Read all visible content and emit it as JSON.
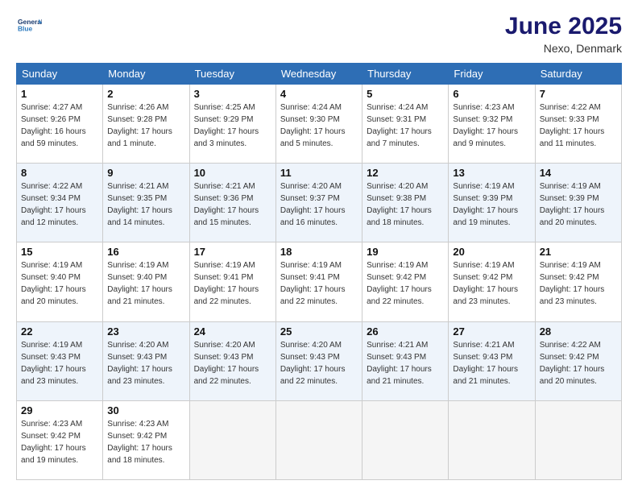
{
  "header": {
    "logo_line1": "General",
    "logo_line2": "Blue",
    "month": "June 2025",
    "location": "Nexo, Denmark"
  },
  "days_of_week": [
    "Sunday",
    "Monday",
    "Tuesday",
    "Wednesday",
    "Thursday",
    "Friday",
    "Saturday"
  ],
  "weeks": [
    [
      {
        "day": "1",
        "sunrise": "4:27 AM",
        "sunset": "9:26 PM",
        "daylight": "16 hours and 59 minutes."
      },
      {
        "day": "2",
        "sunrise": "4:26 AM",
        "sunset": "9:28 PM",
        "daylight": "17 hours and 1 minute."
      },
      {
        "day": "3",
        "sunrise": "4:25 AM",
        "sunset": "9:29 PM",
        "daylight": "17 hours and 3 minutes."
      },
      {
        "day": "4",
        "sunrise": "4:24 AM",
        "sunset": "9:30 PM",
        "daylight": "17 hours and 5 minutes."
      },
      {
        "day": "5",
        "sunrise": "4:24 AM",
        "sunset": "9:31 PM",
        "daylight": "17 hours and 7 minutes."
      },
      {
        "day": "6",
        "sunrise": "4:23 AM",
        "sunset": "9:32 PM",
        "daylight": "17 hours and 9 minutes."
      },
      {
        "day": "7",
        "sunrise": "4:22 AM",
        "sunset": "9:33 PM",
        "daylight": "17 hours and 11 minutes."
      }
    ],
    [
      {
        "day": "8",
        "sunrise": "4:22 AM",
        "sunset": "9:34 PM",
        "daylight": "17 hours and 12 minutes."
      },
      {
        "day": "9",
        "sunrise": "4:21 AM",
        "sunset": "9:35 PM",
        "daylight": "17 hours and 14 minutes."
      },
      {
        "day": "10",
        "sunrise": "4:21 AM",
        "sunset": "9:36 PM",
        "daylight": "17 hours and 15 minutes."
      },
      {
        "day": "11",
        "sunrise": "4:20 AM",
        "sunset": "9:37 PM",
        "daylight": "17 hours and 16 minutes."
      },
      {
        "day": "12",
        "sunrise": "4:20 AM",
        "sunset": "9:38 PM",
        "daylight": "17 hours and 18 minutes."
      },
      {
        "day": "13",
        "sunrise": "4:19 AM",
        "sunset": "9:39 PM",
        "daylight": "17 hours and 19 minutes."
      },
      {
        "day": "14",
        "sunrise": "4:19 AM",
        "sunset": "9:39 PM",
        "daylight": "17 hours and 20 minutes."
      }
    ],
    [
      {
        "day": "15",
        "sunrise": "4:19 AM",
        "sunset": "9:40 PM",
        "daylight": "17 hours and 20 minutes."
      },
      {
        "day": "16",
        "sunrise": "4:19 AM",
        "sunset": "9:40 PM",
        "daylight": "17 hours and 21 minutes."
      },
      {
        "day": "17",
        "sunrise": "4:19 AM",
        "sunset": "9:41 PM",
        "daylight": "17 hours and 22 minutes."
      },
      {
        "day": "18",
        "sunrise": "4:19 AM",
        "sunset": "9:41 PM",
        "daylight": "17 hours and 22 minutes."
      },
      {
        "day": "19",
        "sunrise": "4:19 AM",
        "sunset": "9:42 PM",
        "daylight": "17 hours and 22 minutes."
      },
      {
        "day": "20",
        "sunrise": "4:19 AM",
        "sunset": "9:42 PM",
        "daylight": "17 hours and 23 minutes."
      },
      {
        "day": "21",
        "sunrise": "4:19 AM",
        "sunset": "9:42 PM",
        "daylight": "17 hours and 23 minutes."
      }
    ],
    [
      {
        "day": "22",
        "sunrise": "4:19 AM",
        "sunset": "9:43 PM",
        "daylight": "17 hours and 23 minutes."
      },
      {
        "day": "23",
        "sunrise": "4:20 AM",
        "sunset": "9:43 PM",
        "daylight": "17 hours and 23 minutes."
      },
      {
        "day": "24",
        "sunrise": "4:20 AM",
        "sunset": "9:43 PM",
        "daylight": "17 hours and 22 minutes."
      },
      {
        "day": "25",
        "sunrise": "4:20 AM",
        "sunset": "9:43 PM",
        "daylight": "17 hours and 22 minutes."
      },
      {
        "day": "26",
        "sunrise": "4:21 AM",
        "sunset": "9:43 PM",
        "daylight": "17 hours and 21 minutes."
      },
      {
        "day": "27",
        "sunrise": "4:21 AM",
        "sunset": "9:43 PM",
        "daylight": "17 hours and 21 minutes."
      },
      {
        "day": "28",
        "sunrise": "4:22 AM",
        "sunset": "9:42 PM",
        "daylight": "17 hours and 20 minutes."
      }
    ],
    [
      {
        "day": "29",
        "sunrise": "4:23 AM",
        "sunset": "9:42 PM",
        "daylight": "17 hours and 19 minutes."
      },
      {
        "day": "30",
        "sunrise": "4:23 AM",
        "sunset": "9:42 PM",
        "daylight": "17 hours and 18 minutes."
      },
      null,
      null,
      null,
      null,
      null
    ]
  ],
  "labels": {
    "sunrise": "Sunrise:",
    "sunset": "Sunset:",
    "daylight": "Daylight:"
  }
}
